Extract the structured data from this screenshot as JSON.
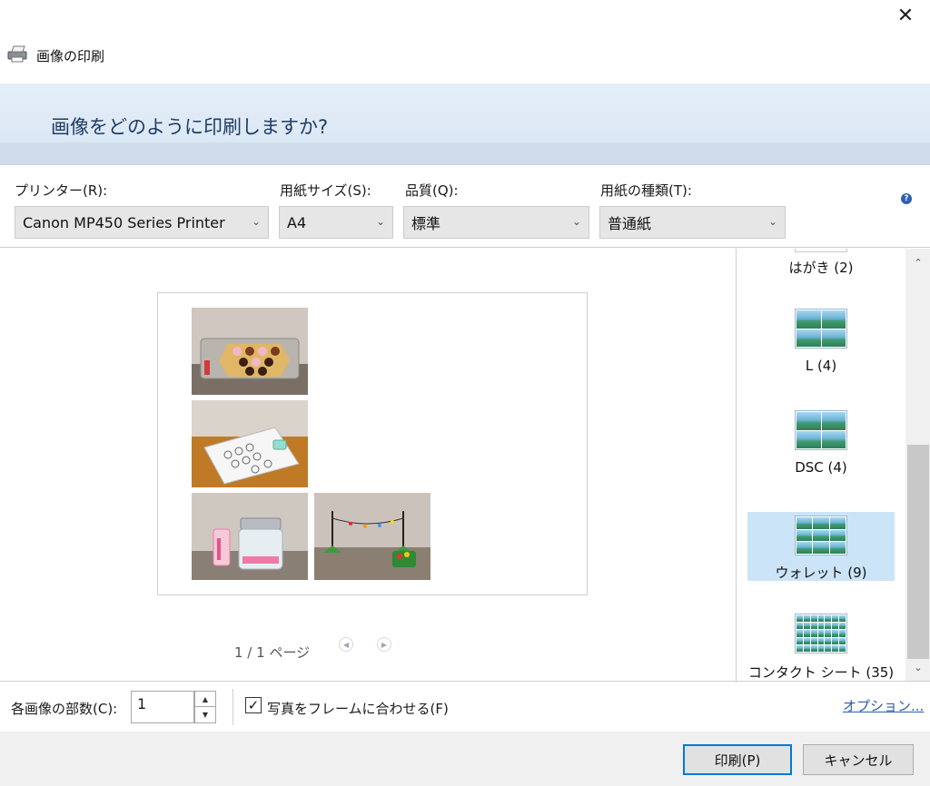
{
  "window": {
    "title": "画像の印刷",
    "close_glyph": "✕"
  },
  "banner": {
    "heading": "画像をどのように印刷しますか?"
  },
  "options": {
    "printer": {
      "label": "プリンター(R):",
      "value": "Canon MP450 Series Printer"
    },
    "paper_size": {
      "label": "用紙サイズ(S):",
      "value": "A4"
    },
    "quality": {
      "label": "品質(Q):",
      "value": "標準"
    },
    "paper_type": {
      "label": "用紙の種類(T):",
      "value": "普通紙"
    },
    "help_glyph": "?"
  },
  "preview": {
    "page_info": "1 / 1 ページ",
    "photos": [
      {
        "name": "donut-tray-photo"
      },
      {
        "name": "drawing-paper-photo"
      },
      {
        "name": "glass-jar-photo"
      },
      {
        "name": "stand-toy-photo"
      }
    ]
  },
  "layouts": {
    "items": [
      {
        "caption": "はがき (2)"
      },
      {
        "caption": "L (4)"
      },
      {
        "caption": "DSC (4)"
      },
      {
        "caption": "ウォレット (9)",
        "selected": true
      },
      {
        "caption": "コンタクト シート (35)"
      }
    ]
  },
  "bottom": {
    "copies_label": "各画像の部数(C):",
    "copies_value": "1",
    "fit_label": "写真をフレームに合わせる(F)",
    "fit_checked": true,
    "options_link": "オプション..."
  },
  "footer": {
    "print_button": "印刷(P)",
    "cancel_button": "キャンセル"
  },
  "colors": {
    "banner": "#d8e5f3",
    "heading": "#1f3d66",
    "selected_layout": "#cce4f7",
    "link": "#2a5ca8",
    "primary_border": "#0078d7"
  }
}
